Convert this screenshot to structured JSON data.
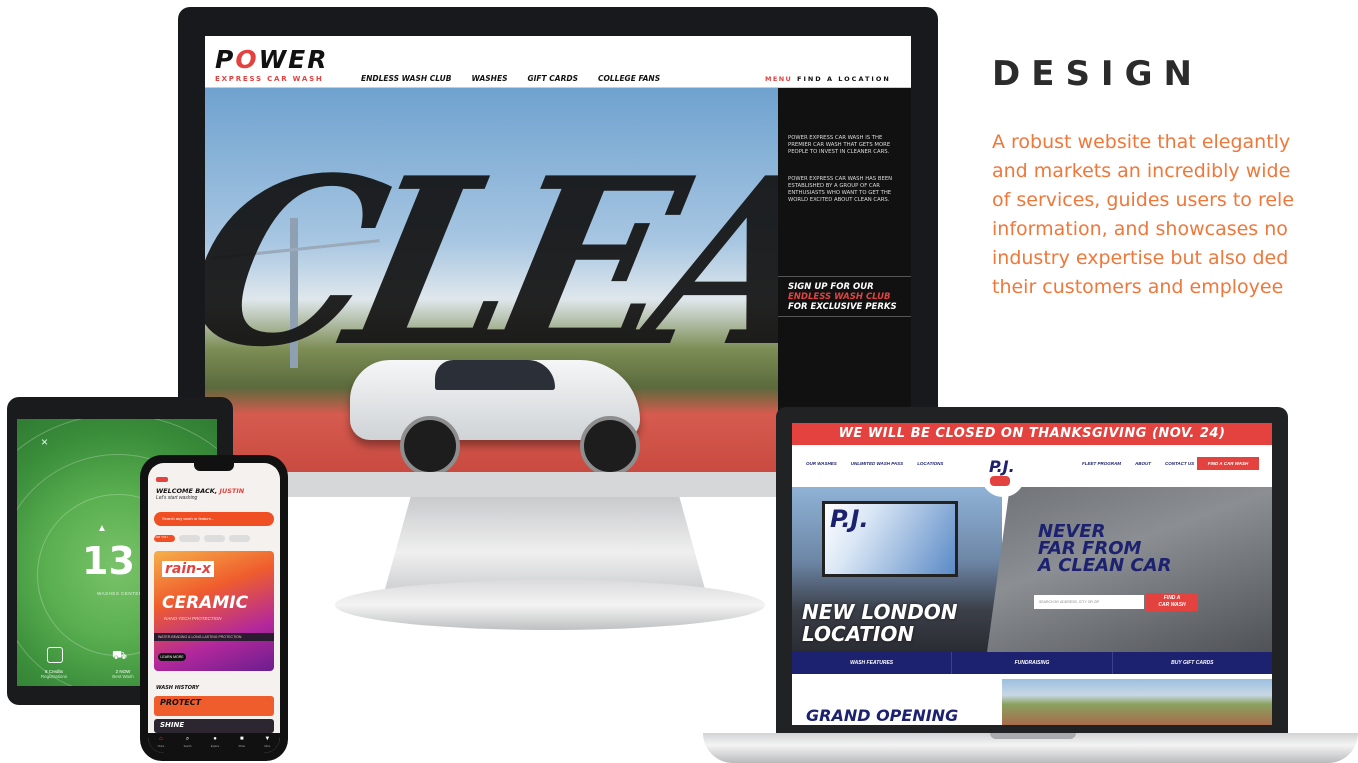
{
  "design": {
    "heading": "DESIGN",
    "body_lines": [
      "A robust website that elegantly",
      "and markets an incredibly wide",
      "of services, guides users to rele",
      "information, and showcases no",
      "industry expertise but also ded",
      "their customers and employee"
    ]
  },
  "power_site": {
    "logo_prefix": "P",
    "logo_o": "O",
    "logo_suffix": "WER",
    "tagline": "EXPRESS CAR WASH",
    "nav": [
      "ENDLESS WASH CLUB",
      "WASHES",
      "GIFT CARDS",
      "COLLEGE FANS"
    ],
    "menu_label": "MENU",
    "find_location": "FIND A LOCATION",
    "hero_word": "CLEAN",
    "side_paragraph_1": "POWER EXPRESS CAR WASH IS THE PREMIER CAR WASH THAT GETS MORE PEOPLE TO INVEST IN CLEANER CARS.",
    "side_paragraph_2": "POWER EXPRESS CAR WASH HAS BEEN ESTABLISHED BY A GROUP OF CAR ENTHUSIASTS WHO WANT TO GET THE WORLD EXCITED ABOUT CLEAN CARS.",
    "signup_line1": "SIGN UP FOR OUR",
    "signup_line2": "ENDLESS WASH CLUB",
    "signup_line3": "FOR EXCLUSIVE PERKS"
  },
  "tablet_app": {
    "close_glyph": "×",
    "count": "13",
    "count_label": "WASHES CENTER",
    "stat1_value": "8 Credits",
    "stat1_label": "Registrations",
    "stat2_value": "2 NOW",
    "stat2_label": "Best Wash"
  },
  "phone_app": {
    "welcome_prefix": "WELCOME BACK,",
    "welcome_name": "JUSTIN",
    "subtitle": "Let's start washing",
    "search_placeholder": "Search any wash or feature...",
    "chips": [
      "FOR YOU",
      "",
      "",
      ""
    ],
    "brand": "rain-x",
    "promo_title": "CERAMIC",
    "promo_sub": "NANO-TECH PROTECTION",
    "promo_strip": "WATER-BEADING & LONG-LASTING PROTECTION",
    "learn_more": "LEARN MORE",
    "history_label": "WASH HISTORY",
    "history_items": [
      "PROTECT",
      "SHINE"
    ],
    "tabs": [
      {
        "icon": "⌂",
        "label": "Home"
      },
      {
        "icon": "⌕",
        "label": "Search"
      },
      {
        "icon": "●",
        "label": "Explore"
      },
      {
        "icon": "■",
        "label": "Photo"
      },
      {
        "icon": "▼",
        "label": "More"
      }
    ]
  },
  "pj_site": {
    "banner": "WE WILL BE CLOSED ON THANKSGIVING (NOV. 24)",
    "nav_left": [
      "OUR WASHES",
      "UNLIMITED WASH PASS",
      "LOCATIONS"
    ],
    "nav_right": [
      "FLEET PROGRAM",
      "ABOUT",
      "CONTACT US"
    ],
    "find_button": "FIND A CAR WASH",
    "logo_text": "P.J.",
    "billboard_text": "P.J.",
    "new_london_1": "NEW LONDON",
    "new_london_2": "LOCATION",
    "never_1": "NEVER",
    "never_2": "FAR FROM",
    "never_3": "A CLEAN CAR",
    "search_placeholder": "SEARCH BY ADDRESS, CITY OR ZIP",
    "search_button_1": "FIND A",
    "search_button_2": "CAR WASH",
    "subnav": [
      "WASH FEATURES",
      "FUNDRAISING",
      "BUY GIFT CARDS"
    ],
    "grand_opening": "GRAND OPENING"
  },
  "colors": {
    "accent_orange": "#f0773a",
    "power_red": "#e4423e",
    "pj_navy": "#1c2170"
  }
}
